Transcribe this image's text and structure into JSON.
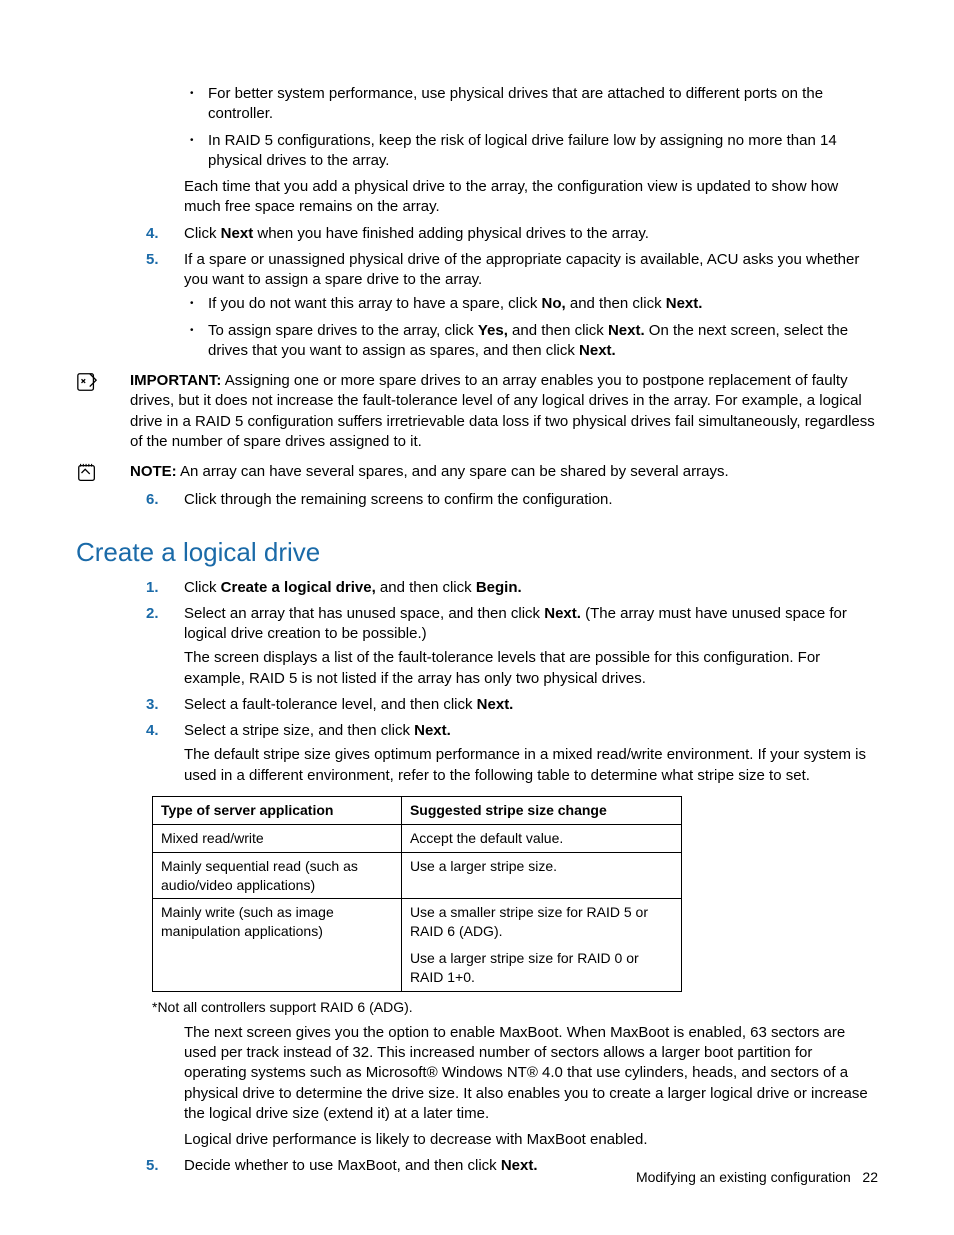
{
  "top": {
    "bullets": [
      "For better system performance, use physical drives that are attached to different ports on the controller.",
      "In RAID 5 configurations, keep the risk of logical drive failure low by assigning no more than 14 physical drives to the array."
    ],
    "after_bullets": "Each time that you add a physical drive to the array, the configuration view is updated to show how much free space remains on the array."
  },
  "steps_a": {
    "s4": {
      "num": "4.",
      "pre": "Click ",
      "b1": "Next",
      "post": " when you have finished adding physical drives to the array."
    },
    "s5": {
      "num": "5.",
      "text": "If a spare or unassigned physical drive of the appropriate capacity is available, ACU asks you whether you want to assign a spare drive to the array.",
      "sub": [
        {
          "pre": "If you do not want this array to have a spare, click ",
          "b1": "No,",
          "mid": " and then click ",
          "b2": "Next."
        },
        {
          "pre": "To assign spare drives to the array, click ",
          "b1": "Yes,",
          "mid": " and then click ",
          "b2": "Next.",
          "post": " On the next screen, select the drives that you want to assign as spares, and then click ",
          "b3": "Next."
        }
      ]
    }
  },
  "important": {
    "label": "IMPORTANT:",
    "text": " Assigning one or more spare drives to an array enables you to postpone replacement of faulty drives, but it does not increase the fault-tolerance level of any logical drives in the array. For example, a logical drive in a RAID 5 configuration suffers irretrievable data loss if two physical drives fail simultaneously, regardless of the number of spare drives assigned to it."
  },
  "note": {
    "label": "NOTE:",
    "text": " An array can have several spares, and any spare can be shared by several arrays."
  },
  "steps_a6": {
    "num": "6.",
    "text": "Click through the remaining screens to confirm the configuration."
  },
  "section_heading": "Create a logical drive",
  "steps_b": {
    "s1": {
      "num": "1.",
      "pre": "Click ",
      "b1": "Create a logical drive,",
      "mid": " and then click ",
      "b2": "Begin."
    },
    "s2": {
      "num": "2.",
      "pre": "Select an array that has unused space, and then click ",
      "b1": "Next.",
      "post": " (The array must have unused space for logical drive creation to be possible.)",
      "body": "The screen displays a list of the fault-tolerance levels that are possible for this configuration. For example, RAID 5 is not listed if the array has only two physical drives."
    },
    "s3": {
      "num": "3.",
      "pre": "Select a fault-tolerance level, and then click ",
      "b1": "Next."
    },
    "s4": {
      "num": "4.",
      "pre": "Select a stripe size, and then click ",
      "b1": "Next.",
      "body": "The default stripe size gives optimum performance in a mixed read/write environment. If your system is used in a different environment, refer to the following table to determine what stripe size to set."
    },
    "s5": {
      "num": "5.",
      "pre": "Decide whether to use MaxBoot, and then click ",
      "b1": "Next."
    }
  },
  "table": {
    "h1": "Type of server application",
    "h2": "Suggested stripe size change",
    "rows": [
      {
        "a": "Mixed read/write",
        "b": "Accept the default value."
      },
      {
        "a": "Mainly sequential read (such as audio/video applications)",
        "b": "Use a larger stripe size."
      },
      {
        "a": "Mainly write (such as image manipulation applications)",
        "b": "Use a smaller stripe size for RAID 5 or RAID 6 (ADG).",
        "c": "Use a larger stripe size for RAID 0 or RAID 1+0."
      }
    ]
  },
  "table_footnote": "*Not all controllers support RAID 6 (ADG).",
  "maxboot_para": "The next screen gives you the option to enable MaxBoot. When MaxBoot is enabled, 63 sectors are used per track instead of 32. This increased number of sectors allows a larger boot partition for operating systems such as Microsoft® Windows NT® 4.0 that use cylinders, heads, and sectors of a physical drive to determine the drive size. It also enables you to create a larger logical drive or increase the logical drive size (extend it) at a later time.",
  "maxboot_perf": "Logical drive performance is likely to decrease with MaxBoot enabled.",
  "footer": {
    "text": "Modifying an existing configuration",
    "page": "22"
  }
}
